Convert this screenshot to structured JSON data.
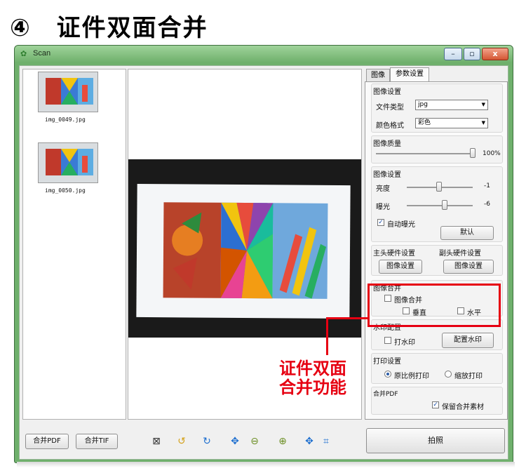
{
  "heading": {
    "number": "④",
    "title": "证件双面合并"
  },
  "window": {
    "title": "Scan",
    "buttons": {
      "minimize": "–",
      "maximize": "▫",
      "close": "x"
    }
  },
  "thumbnails": [
    {
      "caption": "img_0049.jpg"
    },
    {
      "caption": "img_0050.jpg"
    }
  ],
  "bottom_buttons": {
    "merge_pdf": "合并PDF",
    "merge_tif": "合并TIF",
    "capture": "拍照"
  },
  "toolbar_icons": [
    "crop-icon",
    "rotate-left-icon",
    "rotate-right-icon",
    "move-icon",
    "zoom-out-icon",
    "zoom-in-icon",
    "pan-icon",
    "fit-icon"
  ],
  "tabs": [
    {
      "label": "图像"
    },
    {
      "label": "参数设置"
    }
  ],
  "image_settings": {
    "title": "图像设置",
    "file_type_label": "文件类型",
    "file_type_value": "jpg",
    "color_format_label": "颜色格式",
    "color_format_value": "彩色"
  },
  "quality": {
    "title": "图像质量",
    "value_label": "100%",
    "value": 100
  },
  "image_adjust": {
    "title": "图像设置",
    "brightness_label": "亮度",
    "brightness_value": "-1",
    "exposure_label": "曝光",
    "exposure_value": "-6",
    "auto_exposure_label": "自动曝光",
    "default_button": "默认"
  },
  "hardware": {
    "main_label": "主头硬件设置",
    "sub_label": "副头硬件设置",
    "main_button": "图像设置",
    "sub_button": "图像设置"
  },
  "merge": {
    "title": "图像合并",
    "merge_label": "图像合并",
    "vertical_label": "垂直",
    "horizontal_label": "水平"
  },
  "watermark": {
    "title": "水印配置",
    "enable_label": "打水印",
    "config_button": "配置水印"
  },
  "print": {
    "title": "打印设置",
    "original_label": "原比例打印",
    "scaled_label": "缩放打印"
  },
  "merge_pdf": {
    "title": "合并PDF",
    "keep_label": "保留合并素材"
  },
  "annotation": {
    "line1": "证件双面",
    "line2": "合并功能"
  },
  "colors": {
    "accent_red": "#e60012",
    "window_frame": "#6fb06c"
  }
}
